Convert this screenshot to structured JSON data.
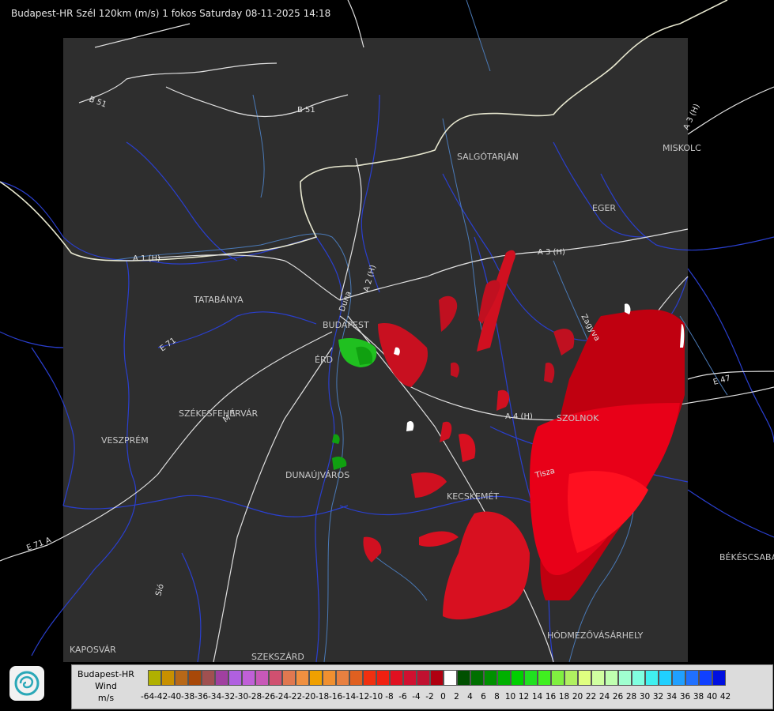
{
  "header": {
    "title": "Budapest-HR Szél 120km (m/s) 1 fokos Saturday 08-11-2025 14:18"
  },
  "map": {
    "places": [
      "SALGÓTARJÁN",
      "MISKOLC",
      "EGER",
      "TATABÁNYA",
      "BUDAPEST",
      "ÉRD",
      "SZÉKESFEHÉRVÁR",
      "VESZPRÉM",
      "DUNAÚJVÁROS",
      "SZOLNOK",
      "KECSKEMÉT",
      "BÉKÉSCSABA",
      "HÓDMEZŐVÁSÁRHELY",
      "KAPOSVÁR",
      "SZEKSZÁRD"
    ],
    "roads": [
      "B 51",
      "B 51",
      "A 3 (H)",
      "A 3 (H)",
      "A 2 (H)",
      "A 1 (H)",
      "M 7",
      "A 4 (H)",
      "E 71",
      "E 71 A",
      "E 47"
    ],
    "rivers": [
      "Duna",
      "Tisza",
      "Sió",
      "Zagyva"
    ]
  },
  "legend": {
    "title_line1": "Budapest-HR",
    "title_line2": "Wind",
    "title_line3": "m/s",
    "values": [
      "-64",
      "-42",
      "-40",
      "-38",
      "-36",
      "-34",
      "-32",
      "-30",
      "-28",
      "-26",
      "-24",
      "-22",
      "-20",
      "-18",
      "-16",
      "-14",
      "-12",
      "-10",
      "-8",
      "-6",
      "-4",
      "-2",
      "0",
      "2",
      "4",
      "6",
      "8",
      "10",
      "12",
      "14",
      "16",
      "18",
      "20",
      "22",
      "24",
      "26",
      "28",
      "30",
      "32",
      "34",
      "36",
      "38",
      "40",
      "42"
    ],
    "colors": [
      "#b0b000",
      "#c89000",
      "#b86818",
      "#a84808",
      "#a05050",
      "#a040a0",
      "#b060e0",
      "#c060d8",
      "#c858b8",
      "#d05070",
      "#e07850",
      "#f09040",
      "#f0a000",
      "#f09030",
      "#e88040",
      "#e06020",
      "#f03010",
      "#f02010",
      "#e01020",
      "#d01030",
      "#c01030",
      "#b00010",
      "#ffffff",
      "#005000",
      "#007000",
      "#009000",
      "#00b000",
      "#00d000",
      "#20e020",
      "#40f020",
      "#80f040",
      "#b0f060",
      "#e0ff80",
      "#d0ffa0",
      "#c0ffb0",
      "#a0ffd0",
      "#80ffe0",
      "#40f0f0",
      "#20d0ff",
      "#20a0ff",
      "#2070ff",
      "#1040ff",
      "#0010e0"
    ]
  },
  "logo": {
    "icon": "weather-service-swirl-logo"
  }
}
